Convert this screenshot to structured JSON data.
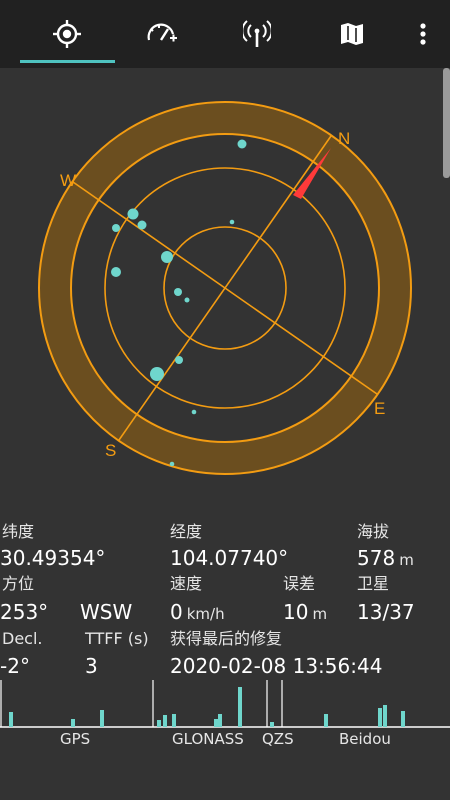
{
  "tabs": [
    {
      "name": "status",
      "icon": "crosshair-target-icon",
      "active": true
    },
    {
      "name": "speed",
      "icon": "speedometer-icon",
      "active": false
    },
    {
      "name": "signal",
      "icon": "antenna-signal-icon",
      "active": false
    },
    {
      "name": "map",
      "icon": "map-icon",
      "active": false
    }
  ],
  "overflow_icon": "vertical-dots-menu-icon",
  "compass": {
    "north": "N",
    "east": "E",
    "south": "S",
    "west": "W",
    "heading_deg": 35,
    "ring_color": "#f39c12",
    "needle_color": "#ff3a3a",
    "sat_color": "#6fd6cc"
  },
  "info": {
    "lat_label": "纬度",
    "lat_value": "30.49354°",
    "lon_label": "经度",
    "lon_value": "104.07740°",
    "alt_label": "海拔",
    "alt_value": "578",
    "alt_unit": "m",
    "bearing_label": "方位",
    "bearing_value": "253°",
    "bearing_dir": "WSW",
    "speed_label": "速度",
    "speed_value": "0",
    "speed_unit": "km/h",
    "error_label": "误差",
    "error_value": "10",
    "error_unit": "m",
    "sats_label": "卫星",
    "sats_value": "13/37",
    "decl_label": "Decl.",
    "decl_value": "-2°",
    "ttff_label": "TTFF (s)",
    "ttff_value": "3",
    "fix_label": "获得最后的修复",
    "fix_value": "2020-02-08 13:56:44"
  },
  "constellations": {
    "gps": "GPS",
    "glonass": "GLONASS",
    "qzs": "QZS",
    "beidou": "Beidou"
  }
}
